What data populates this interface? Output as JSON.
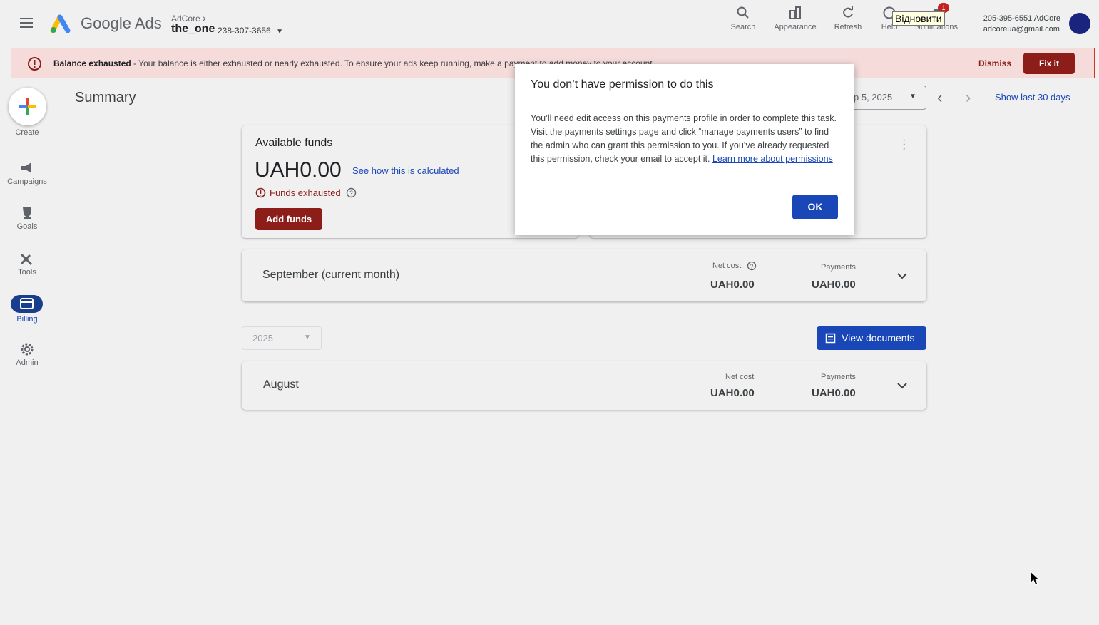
{
  "header": {
    "brand": "Google Ads",
    "account_parent": "AdCore",
    "account_name": "the_one",
    "account_id": "238-307-3656",
    "buttons": [
      {
        "label": "Search",
        "icon": "search-icon"
      },
      {
        "label": "Appearance",
        "icon": "appearance-icon"
      },
      {
        "label": "Refresh",
        "icon": "refresh-icon"
      },
      {
        "label": "Help",
        "icon": "help-icon"
      },
      {
        "label": "Notifications",
        "icon": "bell-icon"
      }
    ],
    "notification_count": "1",
    "tooltip": "Відновити",
    "user_phone": "205-395-6551 AdCore",
    "user_email": "adcoreua@gmail.com"
  },
  "banner": {
    "title": "Balance exhausted",
    "text": " - Your balance is either exhausted or nearly exhausted. To ensure your ads keep running, make a payment to add money to your account.",
    "dismiss": "Dismiss",
    "fix": "Fix it"
  },
  "sidebar": {
    "create": "Create",
    "items": [
      {
        "label": "Campaigns",
        "icon": "megaphone-icon"
      },
      {
        "label": "Goals",
        "icon": "trophy-icon"
      },
      {
        "label": "Tools",
        "icon": "tools-icon"
      },
      {
        "label": "Billing",
        "icon": "billing-icon"
      },
      {
        "label": "Admin",
        "icon": "gear-icon"
      }
    ]
  },
  "main": {
    "title": "Summary",
    "date_range": "p 5, 2025",
    "show_last": "Show last 30 days",
    "funds": {
      "title": "Available funds",
      "amount": "UAH0.00",
      "calc_link": "See how this is calculated",
      "status": "Funds exhausted",
      "add_button": "Add funds"
    },
    "current_month": {
      "title": "September (current month)",
      "net_cost_label": "Net cost",
      "net_cost": "UAH0.00",
      "payments_label": "Payments",
      "payments": "UAH0.00"
    },
    "year": "2025",
    "view_documents": "View documents",
    "august": {
      "title": "August",
      "net_cost_label": "Net cost",
      "net_cost": "UAH0.00",
      "payments_label": "Payments",
      "payments": "UAH0.00"
    }
  },
  "modal": {
    "title": "You don’t have permission to do this",
    "body": "You’ll need edit access on this payments profile in order to complete this task. Visit the payments settings page and click “manage payments users” to find the admin who can grant this permission to you. If you’ve already requested this permission, check your email to accept it. ",
    "link": "Learn more about permissions",
    "ok": "OK"
  },
  "colors": {
    "brand_blue": "#1a47b8",
    "error_red": "#8c1d18",
    "banner_bg": "#f5dcdb"
  }
}
